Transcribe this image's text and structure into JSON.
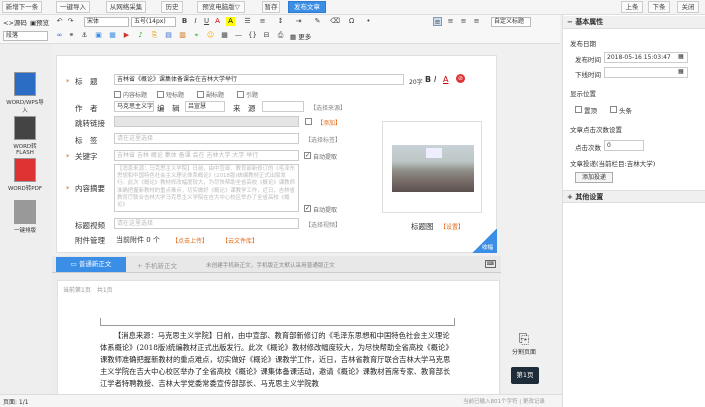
{
  "toolbar_top": {
    "buttons": [
      "新增下一条",
      "一键导入",
      "从网络采集",
      "历史",
      "预览电脑版▽",
      "暂存",
      "发布文章"
    ],
    "right": [
      "上条",
      "下条",
      "关闭"
    ]
  },
  "editor_toolbar": {
    "source": "源码",
    "preview": "预览",
    "font": "宋体",
    "size": "五号(14px)",
    "para": "段落",
    "title_style": "自定义标题",
    "more": "更多"
  },
  "left_tools": [
    "WORD/WPS导入",
    "WORD转FLASH",
    "WORD转PDF",
    "一键排版"
  ],
  "form": {
    "title_label": "标　题",
    "title_value": "吉林省《概论》课集体备课会在吉林大学举行",
    "title_count": "20字",
    "title_options": [
      "内容标题",
      "短标题",
      "副标题",
      "引题"
    ],
    "author_label": "作　者",
    "author_value": "马克思主义字院",
    "editor_label": "编　辑",
    "editor_value": "吕宣慧",
    "source_label": "来　源",
    "source_link": "【选择来源】",
    "jump_label": "跳转链接",
    "jump_add": "【添加】",
    "tag_label": "标　签",
    "tag_placeholder": "请在这里选择",
    "tag_link": "【选择标签】",
    "keyword_label": "关键字",
    "keyword_value": "吉林省 吉林 概论 集体 备课 会在 吉林大学 大学 举行",
    "keyword_auto": "自动提取",
    "summary_label": "内容摘要",
    "summary_value": "【消息来源：马克思主义学院】日前，由中宣部、教育部新修订的《毛泽东思想和中国特色社会主义理论体系概论》(2018版)统编教材正式出版发行。此次《概论》教材修改幅度较大，为尽快帮助全省高校《概论》课教师准确把握新教材的重点难点，切实做好《概论》课教学工作，近日，吉林省教育厅联合吉林大学马克思主义学院在吉大中心校区举办了全省高校《概论》",
    "summary_auto": "自动提取",
    "video_label": "标题视频",
    "video_placeholder": "请在这里选择",
    "video_link": "【选择视频】",
    "attach_label": "附件管理",
    "attach_value": "当前附件 0 个",
    "attach_upload": "【点击上传】",
    "attach_cloud": "【云文件库】",
    "image_label": "标题图",
    "image_link": "【设置】",
    "collapse": "收幅"
  },
  "editor_tabs": {
    "normal": "普通新正文",
    "mobile": "+ 手机新正文",
    "notice": "未创建手机新正文，手机版正文默认采用普通版正文"
  },
  "doc": {
    "page_info": "当前第1页　共1页",
    "body": "【消息来源：马克思主义学院】日前，由中宣部、教育部新修订的《毛泽东思想和中国特色社会主义理论体系概论》(2018版)统编教材正式出版发行。此次《概论》教材修改幅度较大，为尽快帮助全省高校《概论》课教师准确把握新教材的重点难点，切实做好《概论》课教学工作，近日，吉林省教育厅联合吉林大学马克思主义学院在吉大中心校区举办了全省高校《概论》课集体备课活动，邀请《概论》课教材首席专家、教育部长江学者特聘教授、吉林大学党委常委宣传部部长、马克思主义学院教"
  },
  "right_float": {
    "split": "分割页面",
    "page": "第1页"
  },
  "right_panel": {
    "basic_title": "基本属性",
    "publish_date": "发布日期",
    "publish_time_label": "发布时间",
    "publish_time": "2018-05-16 15:03:47",
    "offline_label": "下线时间",
    "display_pos": "显示位置",
    "pin": "置顶",
    "headline": "头条",
    "click_setting": "文章点击次数设置",
    "click_label": "点击次数",
    "click_value": "0",
    "submit_title": "文章投递(当前栏目:吉林大学)",
    "add_submit": "添加投递",
    "other_title": "其他设置"
  },
  "status": {
    "left": "页面: 1/1",
    "right": "当前已输入801个字符 | 更改记录"
  }
}
